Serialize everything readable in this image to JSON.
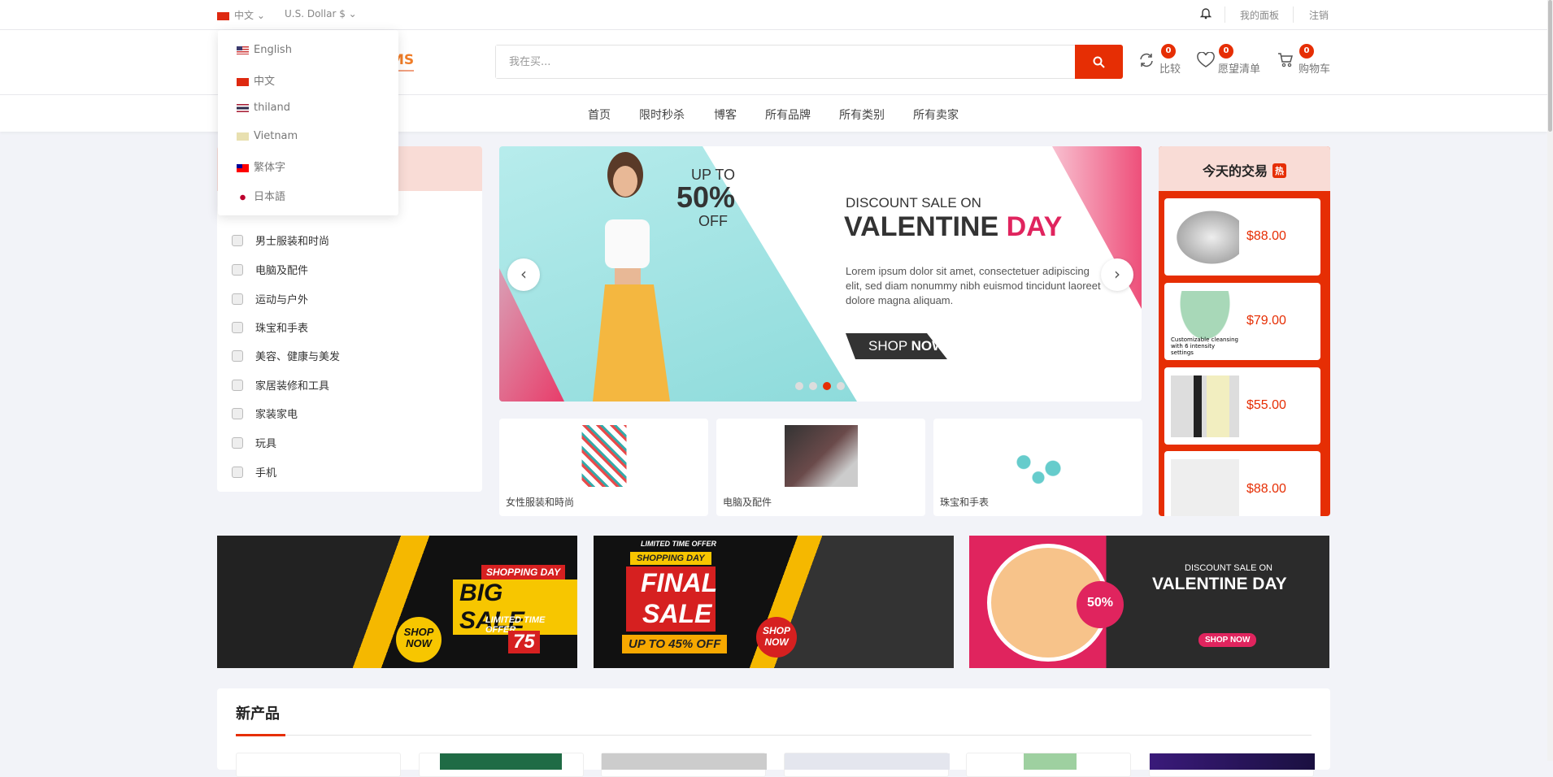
{
  "topbar": {
    "language": "中文",
    "currency": "U.S. Dollar $",
    "dashboard": "我的面板",
    "logout": "注销"
  },
  "language_menu": [
    {
      "label": "English",
      "flag": "us"
    },
    {
      "label": "中文",
      "flag": "cn"
    },
    {
      "label": "thiland",
      "flag": "th"
    },
    {
      "label": "Vietnam",
      "flag": "vn"
    },
    {
      "label": "繁体字",
      "flag": "tw"
    },
    {
      "label": "日本語",
      "flag": "jp"
    }
  ],
  "header": {
    "logo_partial": "MS",
    "search_placeholder": "我在买...",
    "compare": {
      "label": "比较",
      "count": "0"
    },
    "wishlist": {
      "label": "愿望清单",
      "count": "0"
    },
    "cart": {
      "label": "购物车",
      "count": "0"
    }
  },
  "nav": [
    "首页",
    "限时秒杀",
    "博客",
    "所有品牌",
    "所有类别",
    "所有卖家"
  ],
  "categories": [
    "男士服装和时尚",
    "电脑及配件",
    "运动与户外",
    "珠宝和手表",
    "美容、健康与美发",
    "家居装修和工具",
    "家装家电",
    "玩具",
    "手机"
  ],
  "slider": {
    "up_to": "UP TO",
    "percent": "50%",
    "off": "OFF",
    "line1": "DISCOUNT SALE ON",
    "line2a": "VALENTINE",
    "line2b": "DAY",
    "body": "Lorem ipsum dolor sit amet, consectetuer adipiscing elit, sed diam nonummy nibh euismod tincidunt laoreet dolore magna aliquam.",
    "cta_a": "SHOP",
    "cta_b": "NOW",
    "active_dot": 3,
    "dots": 4
  },
  "category_cards": [
    "女性服装和時尚",
    "电脑及配件",
    "珠宝和手表"
  ],
  "deals": {
    "title": "今天的交易",
    "hot": "热",
    "items": [
      {
        "price": "$88.00"
      },
      {
        "price": "$79.00",
        "caption": "Customizable cleansing with 6 intensity settings"
      },
      {
        "price": "$55.00"
      },
      {
        "price": "$88.00"
      }
    ]
  },
  "banners": [
    {
      "tag": "SHOPPING DAY",
      "title": "BIG SALE",
      "sub": "LIMITED TIME OFFER",
      "cta": "SHOP NOW",
      "discount": "75"
    },
    {
      "tag": "SHOPPING DAY",
      "top": "LIMITED TIME OFFER",
      "title1": "FINAL",
      "title2": "SALE",
      "sub": "UP TO 45% OFF",
      "cta": "SHOP NOW"
    },
    {
      "line1": "DISCOUNT SALE ON",
      "title": "VALENTINE DAY",
      "badge": "50%",
      "cta": "SHOP NOW"
    }
  ],
  "new_products": {
    "title": "新产品"
  },
  "colors": {
    "accent": "#e62e04",
    "logo": "#f07d28",
    "page_bg": "#f2f3f8",
    "pink_header": "#f9dcd6"
  }
}
